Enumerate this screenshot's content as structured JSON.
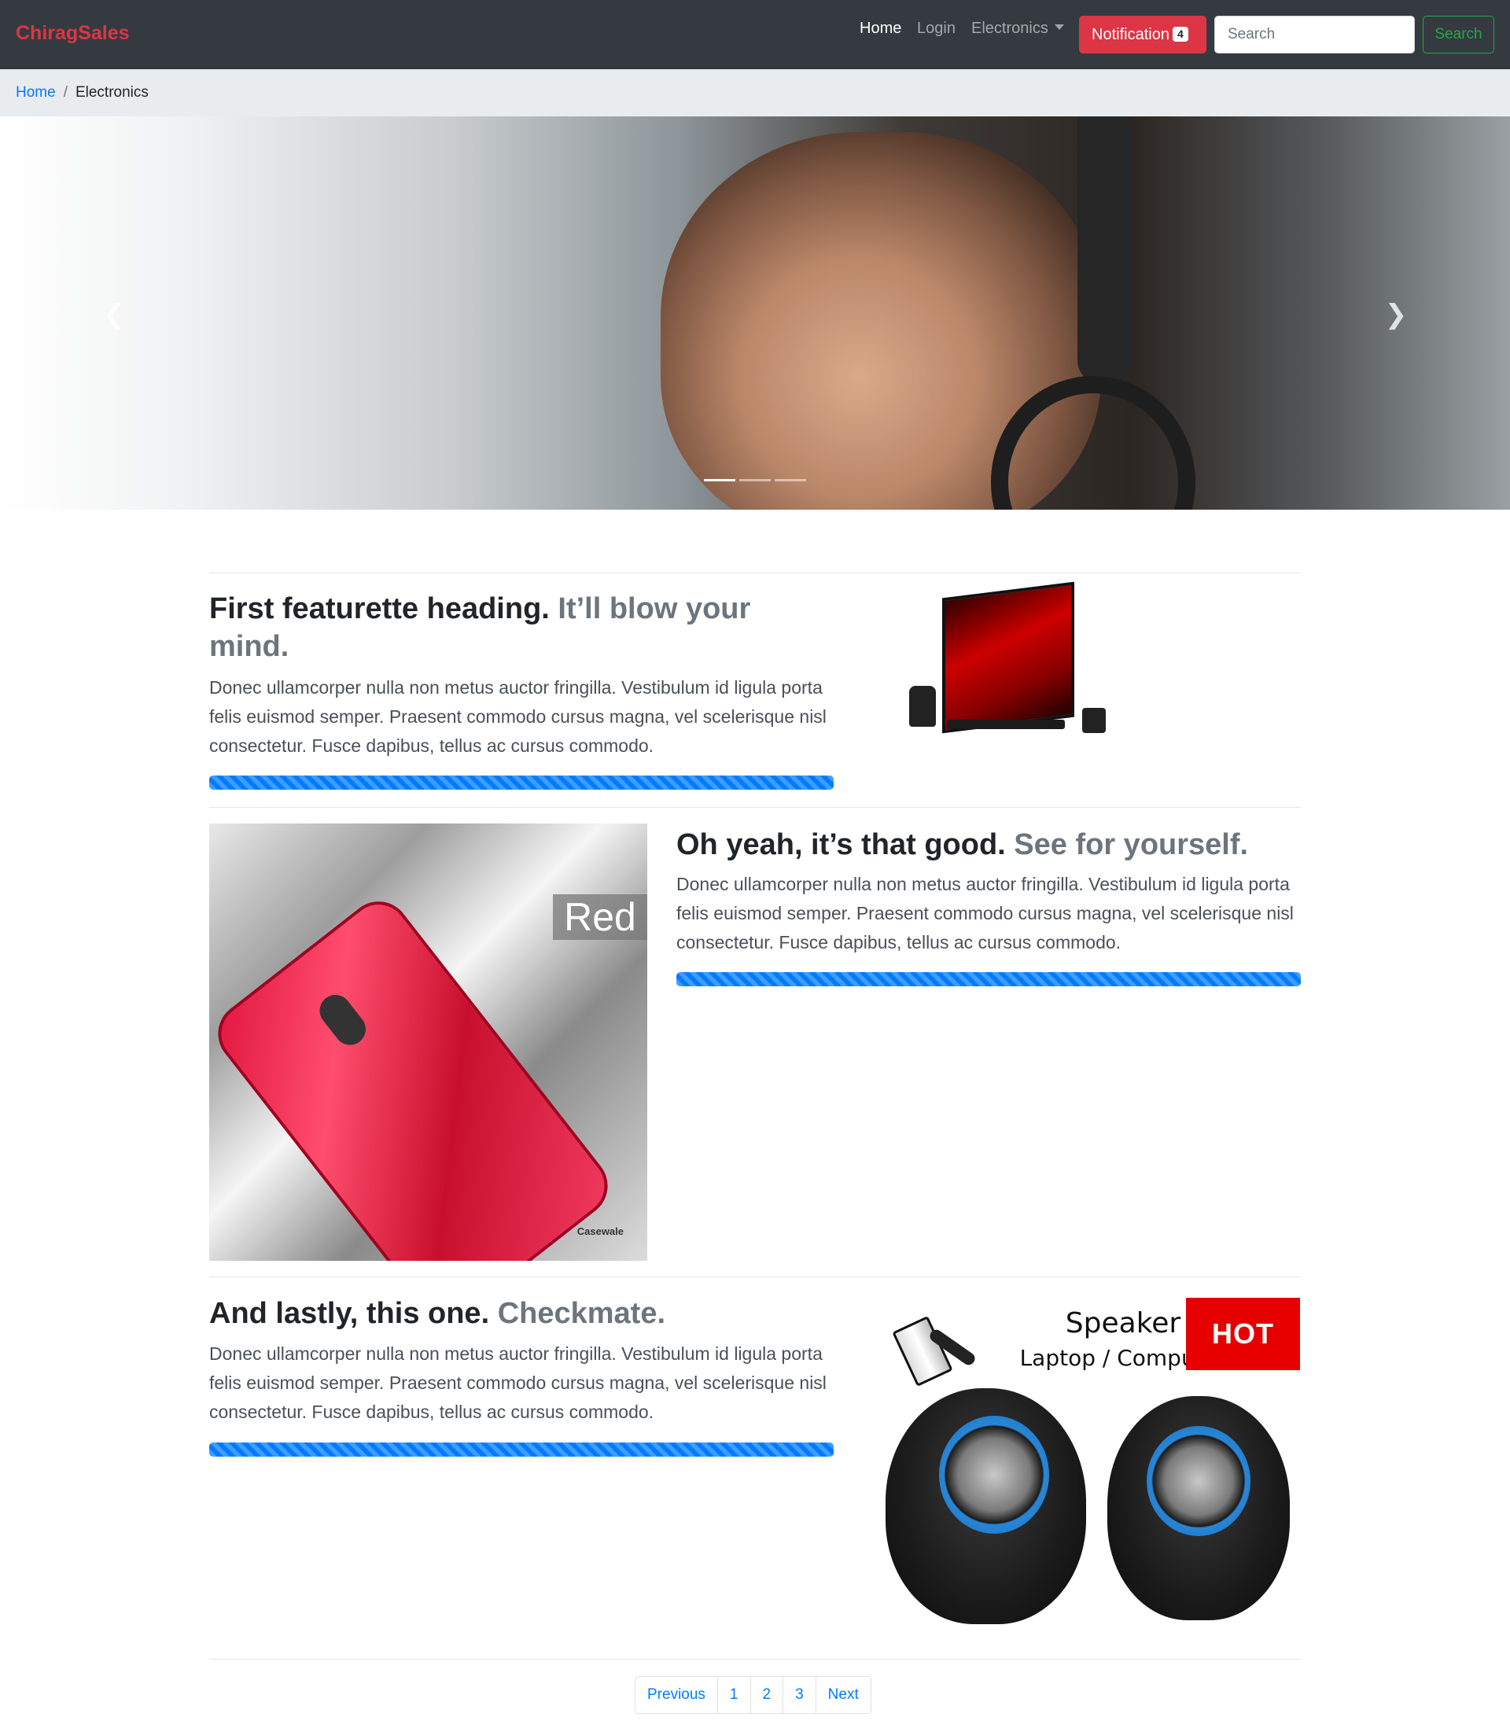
{
  "navbar": {
    "brand": "ChiragSales",
    "links": {
      "home": "Home",
      "login": "Login",
      "electronics": "Electronics"
    },
    "notification_label": "Notification",
    "notification_count": "4",
    "search_placeholder": "Search",
    "search_button": "Search"
  },
  "breadcrumb": {
    "home": "Home",
    "separator": "/",
    "active": "Electronics"
  },
  "carousel": {
    "active_slide": 1,
    "slide_count": 3
  },
  "featurettes": [
    {
      "heading": "First featurette heading.",
      "heading_muted": "It’ll blow your mind.",
      "text": "Donec ullamcorper nulla non metus auctor fringilla. Vestibulum id ligula porta felis euismod semper. Praesent commodo cursus magna, vel scelerisque nisl consectetur. Fusce dapibus, tellus ac cursus commodo.",
      "progress_percent": 100
    },
    {
      "heading": "Oh yeah, it’s that good.",
      "heading_muted": "See for yourself.",
      "text": "Donec ullamcorper nulla non metus auctor fringilla. Vestibulum id ligula porta felis euismod semper. Praesent commodo cursus magna, vel scelerisque nisl consectetur. Fusce dapibus, tellus ac cursus commodo.",
      "progress_percent": 100,
      "image_label": "Red",
      "image_brand": "Casewale"
    },
    {
      "heading": "And lastly, this one.",
      "heading_muted": "Checkmate.",
      "text": "Donec ullamcorper nulla non metus auctor fringilla. Vestibulum id ligula porta felis euismod semper. Praesent commodo cursus magna, vel scelerisque nisl consectetur. Fusce dapibus, tellus ac cursus commodo.",
      "progress_percent": 100,
      "image_title": "Speaker",
      "image_subtitle": "Laptop / Computer",
      "image_badge": "HOT"
    }
  ],
  "pagination": {
    "previous": "Previous",
    "pages": [
      "1",
      "2",
      "3"
    ],
    "next": "Next"
  },
  "colors": {
    "brand": "#dc3545",
    "primary": "#007bff",
    "success": "#28a745",
    "navbar_bg": "#343a40"
  }
}
